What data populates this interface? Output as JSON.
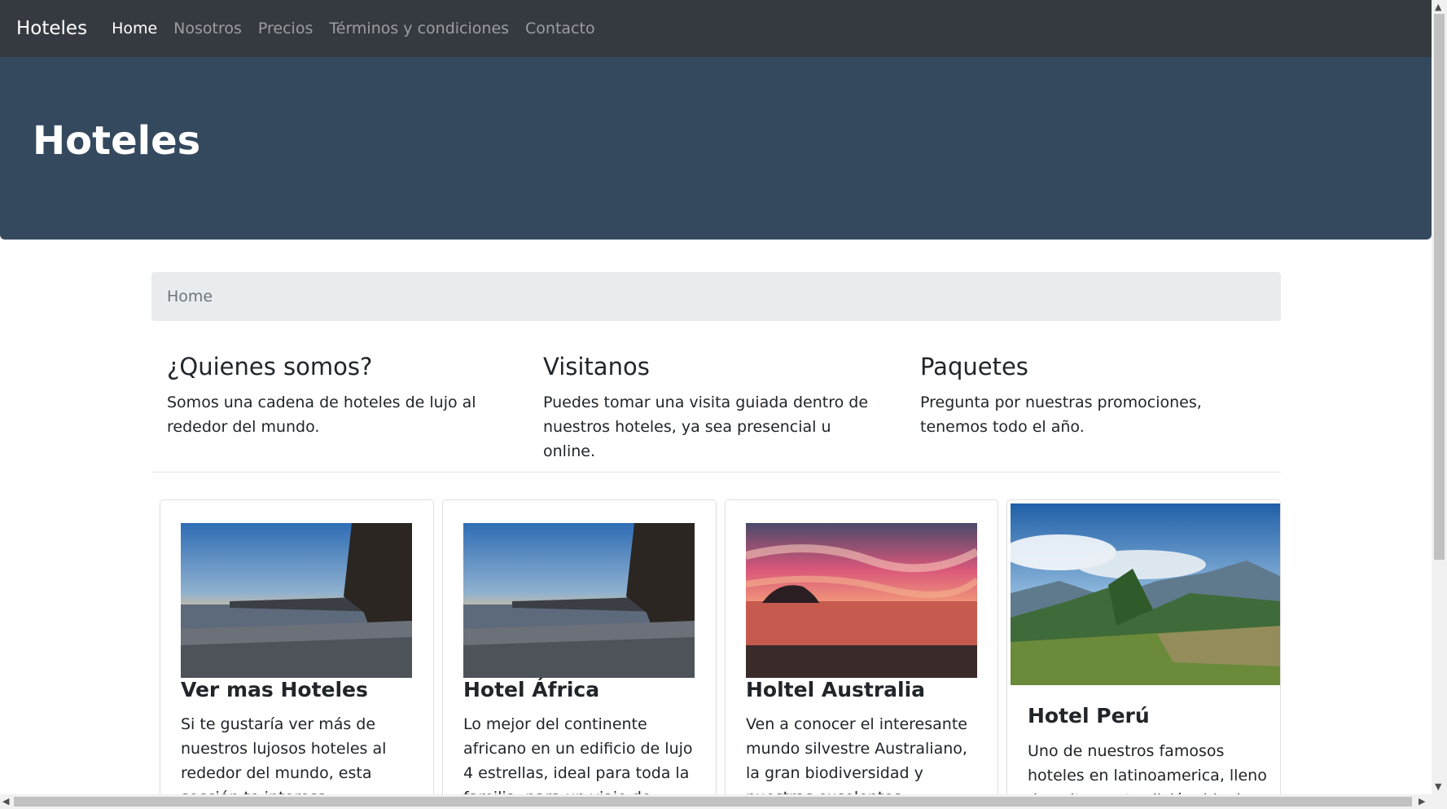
{
  "navbar": {
    "brand": "Hoteles",
    "links": [
      "Home",
      "Nosotros",
      "Precios",
      "Términos y condiciones",
      "Contacto"
    ]
  },
  "hero": {
    "title": "Hoteles"
  },
  "breadcrumb": {
    "current": "Home"
  },
  "info": [
    {
      "title": "¿Quienes somos?",
      "text": "Somos una cadena de hoteles de lujo al rededor del mundo."
    },
    {
      "title": "Visitanos",
      "text": "Puedes tomar una visita guiada dentro de nuestros hoteles, ya sea presencial u online."
    },
    {
      "title": "Paquetes",
      "text": "Pregunta por nuestras promociones, tenemos todo el año."
    }
  ],
  "cards": [
    {
      "title": "Ver mas Hoteles",
      "text": "Si te gustaría ver más de nuestros lujosos hoteles al rededor del mundo, esta sección te interesa."
    },
    {
      "title": "Hotel África",
      "text": "Lo mejor del continente africano en un edificio de lujo 4 estrellas, ideal para toda la familia, para un viaje de pareja."
    },
    {
      "title": "Holtel Australia",
      "text": "Ven a conocer el interesante mundo silvestre Australiano, la gran biodiversidad y nuestras excelentes habitaciones para"
    },
    {
      "title": "Hotel Perú",
      "text": "Uno de nuestros famosos hoteles en latinoamerica, lleno de cultura y tradición, ideal"
    }
  ]
}
